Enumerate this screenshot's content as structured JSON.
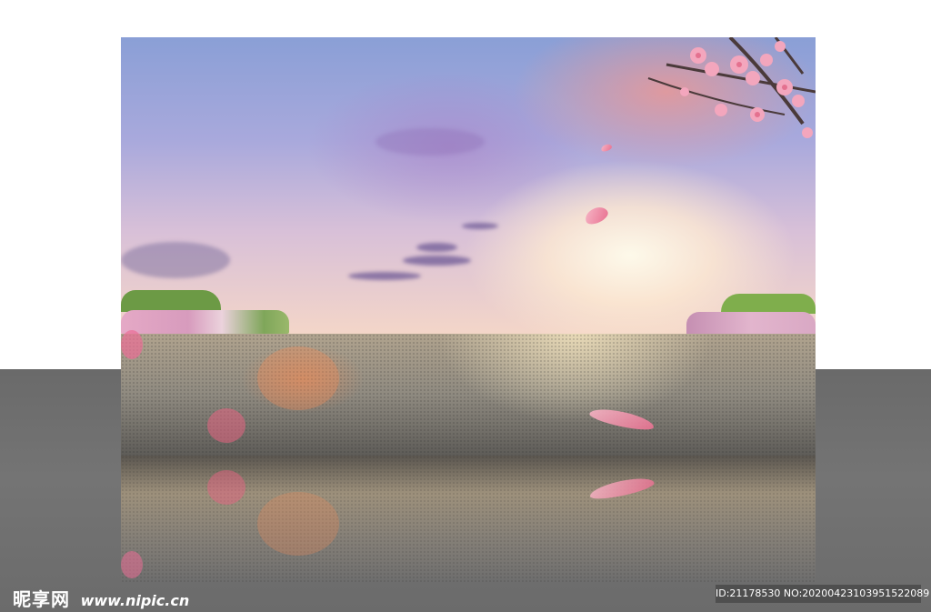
{
  "watermark": {
    "brand_cn": "昵享网",
    "brand_url": "www.nipic.cn",
    "id_text": "ID:21178530 NO:20200423103951522089"
  },
  "scene": {
    "subject": "cherry blossom sunset road backdrop",
    "colors": {
      "sky_top": "#8a9fd6",
      "sky_horizon": "#f4d6c8",
      "blossom_pink": "#e86f8f",
      "floor_gray": "#6a6a6a"
    }
  }
}
